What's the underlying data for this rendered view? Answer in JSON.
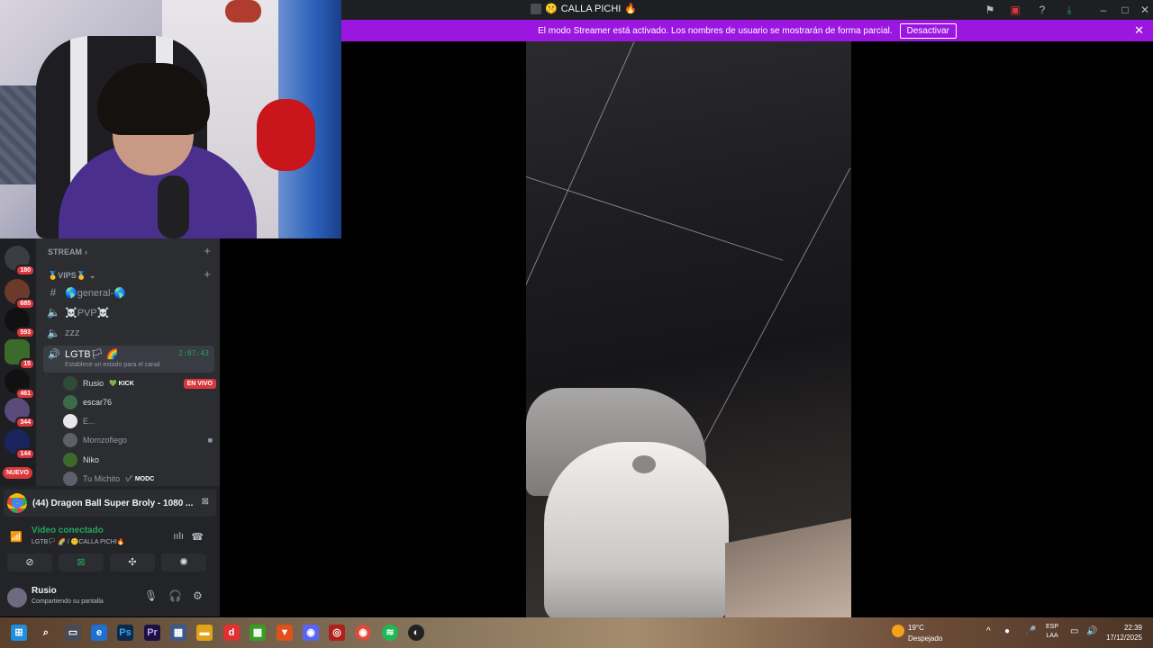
{
  "window": {
    "title": "CALLA PICHI",
    "title_emoji_left": "🤫",
    "title_emoji_right": "�along"
  },
  "banner": {
    "text": "El modo Streamer está activado. Los nombres de usuario se mostrarán de forma parcial.",
    "button": "Desactivar"
  },
  "guilds": [
    {
      "badge": "180"
    },
    {
      "badge": "685"
    },
    {
      "badge": "593"
    },
    {
      "badge": "15"
    },
    {
      "badge": "461"
    },
    {
      "badge": "344"
    },
    {
      "badge": "144"
    }
  ],
  "guild_new": "NUEVO",
  "channels": {
    "category_stream": "STREAM",
    "category_vips": "🥇VIPS🥇",
    "items": [
      {
        "name": "🌎general-🌎",
        "type": "text"
      },
      {
        "name": "☠️PVP☠️",
        "type": "voice"
      },
      {
        "name": "zzz",
        "type": "voice"
      }
    ],
    "active": {
      "name": "LGTB🏳 🌈",
      "time": "2:07:43",
      "status": "Establece un estado para el canal"
    },
    "users": [
      {
        "name": "Rusio",
        "tag": "💚 KICK",
        "live": "EN VIVO"
      },
      {
        "name": "escar76"
      },
      {
        "name": "E..."
      },
      {
        "name": "Momzofiego"
      },
      {
        "name": "Niko"
      },
      {
        "name": "Tu Michito",
        "tag": "✔️ MODC"
      }
    ]
  },
  "activity": {
    "text": "(44) Dragon Ball Super Broly - 1080 ..."
  },
  "voice": {
    "title": "Video conectado",
    "subtitle": "LGTB🏳 🌈 / 🤫CALLA PICHI🔥"
  },
  "user": {
    "name": "Rusio",
    "status": "Compartiendo su pantalla"
  },
  "taskbar": {
    "weather_temp": "19°C",
    "weather_desc": "Despejado",
    "lang_1": "ESP",
    "lang_2": "LAA",
    "time": "22:39",
    "date": "17/12/2025"
  }
}
